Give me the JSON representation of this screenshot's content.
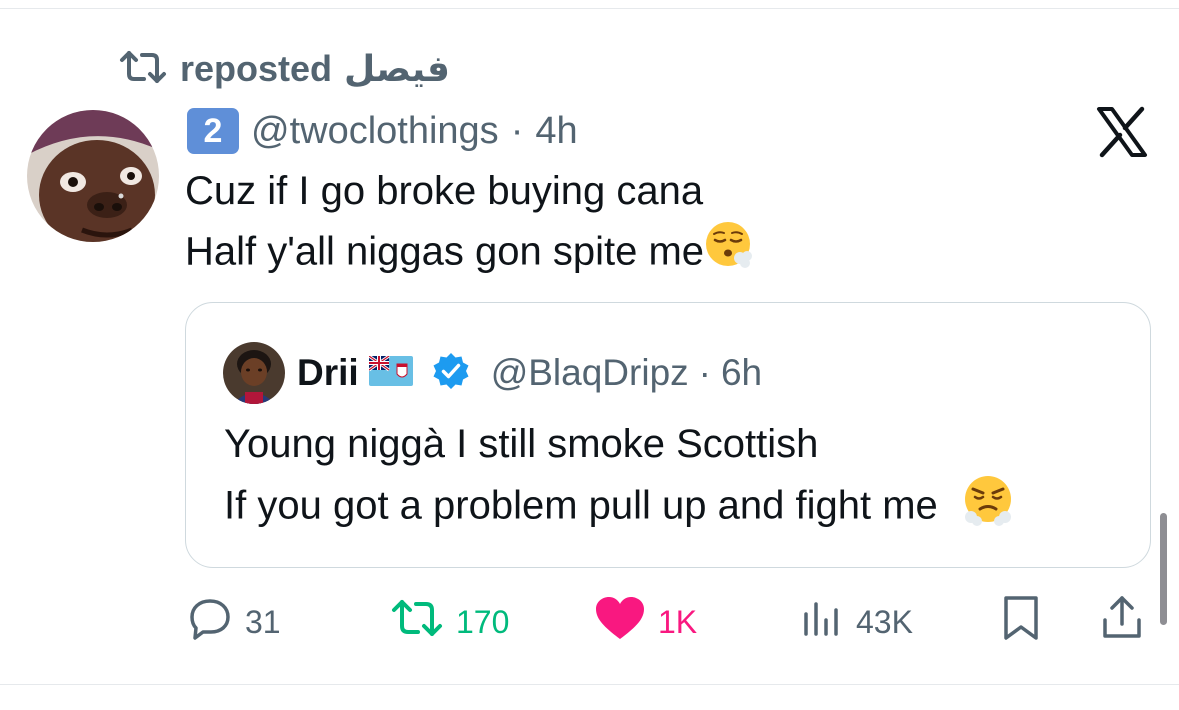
{
  "repost": {
    "label": "reposted",
    "user": "فيصل"
  },
  "tweet": {
    "badge": "2",
    "handle": "@twoclothings",
    "separator": "·",
    "time": "4h",
    "lines": [
      "Cuz if I go broke buying cana",
      "Half y'all niggas gon spite me"
    ]
  },
  "quote": {
    "name": "Drii",
    "handle": "@BlaqDripz",
    "separator": "·",
    "time": "6h",
    "lines": [
      "Young niggà I still smoke Scottish",
      "If you got a problem pull up and fight me"
    ]
  },
  "actions": {
    "replies": "31",
    "reposts": "170",
    "likes": "1K",
    "views": "43K"
  },
  "colors": {
    "text_primary": "#0f1419",
    "text_secondary": "#536471",
    "repost_green": "#00ba7c",
    "like_pink": "#f91880",
    "verified_blue": "#1d9bf0"
  },
  "icons": [
    "repost-icon",
    "keycap-2-icon",
    "x-logo-icon",
    "exhale-emoji-icon",
    "flag-icon",
    "verified-badge-icon",
    "steam-nose-emoji-icon",
    "reply-icon",
    "heart-icon",
    "views-icon",
    "bookmark-icon",
    "share-icon"
  ]
}
